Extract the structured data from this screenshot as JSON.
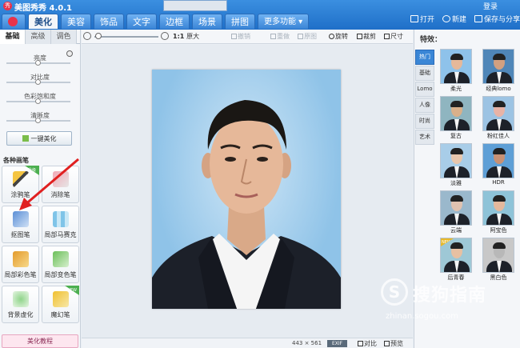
{
  "app": {
    "title": "美图秀秀 4.0.1",
    "login": "登录"
  },
  "tabs": [
    {
      "label": "美化",
      "active": true
    },
    {
      "label": "美容"
    },
    {
      "label": "饰品"
    },
    {
      "label": "文字"
    },
    {
      "label": "边框"
    },
    {
      "label": "场景"
    },
    {
      "label": "拼图"
    },
    {
      "label": "更多功能 ▾"
    }
  ],
  "top_actions": {
    "open": "打开",
    "new": "新建",
    "save": "保存与分享"
  },
  "left": {
    "subtabs": [
      "基础",
      "高级",
      "调色"
    ],
    "sliders": [
      {
        "label": "亮度",
        "level": 0.5
      },
      {
        "label": "对比度",
        "level": 0.5
      },
      {
        "label": "色彩饱和度",
        "level": 0.5
      },
      {
        "label": "清晰度",
        "level": 0.5
      }
    ],
    "one_key": "一键美化",
    "section_title": "各种画笔",
    "pens": [
      {
        "label": "涂鸦笔",
        "badge": "升级"
      },
      {
        "label": "消除笔"
      },
      {
        "label": "抠图笔"
      },
      {
        "label": "局部马赛克"
      },
      {
        "label": "局部彩色笔"
      },
      {
        "label": "局部变色笔"
      },
      {
        "label": "背景虚化"
      },
      {
        "label": "魔幻笔",
        "badge": "NEW"
      }
    ],
    "tutorial": "美化教程"
  },
  "toolbar": {
    "zoom_ratio": "1:1",
    "original_size": "原大",
    "undo": "撤销",
    "redo": "重做",
    "original": "原图",
    "rotate": "旋转",
    "crop": "裁剪",
    "resize": "尺寸"
  },
  "status": {
    "dimensions": "443 × 561",
    "exif": "EXIF",
    "compare": "对比",
    "preview": "预览"
  },
  "right": {
    "title": "特效：",
    "categories": [
      "热门",
      "基础",
      "Lomo",
      "人像",
      "时尚",
      "艺术"
    ],
    "effects": [
      {
        "label": "柔光",
        "bg": "#8ec2ea",
        "skin": "#e6b89a"
      },
      {
        "label": "经典lomo",
        "bg": "#4f86b8",
        "skin": "#d2a080"
      },
      {
        "label": "复古",
        "bg": "#8fb5c0",
        "skin": "#d9b08a"
      },
      {
        "label": "粉红佳人",
        "bg": "#9cc3e3",
        "skin": "#e8b3a6"
      },
      {
        "label": "淡雅",
        "bg": "#a8cde8",
        "skin": "#e8c7ad"
      },
      {
        "label": "HDR",
        "bg": "#5e9fd6",
        "skin": "#c99174"
      },
      {
        "label": "云端",
        "bg": "#9ab8cc",
        "skin": "#e0c2b0"
      },
      {
        "label": "阿宝色",
        "bg": "#8ec3d8",
        "skin": "#e4b89c"
      },
      {
        "label": "后青春",
        "bg": "#9ec8d6",
        "skin": "#e8c0a2",
        "badge": "NEW"
      },
      {
        "label": "黑白色",
        "bg": "#c8c8c8",
        "skin": "#b8b8b8"
      }
    ]
  },
  "watermark": {
    "cn": "搜狗指南",
    "url": "zhinan.sogou.com",
    "logo_letter": "S"
  }
}
